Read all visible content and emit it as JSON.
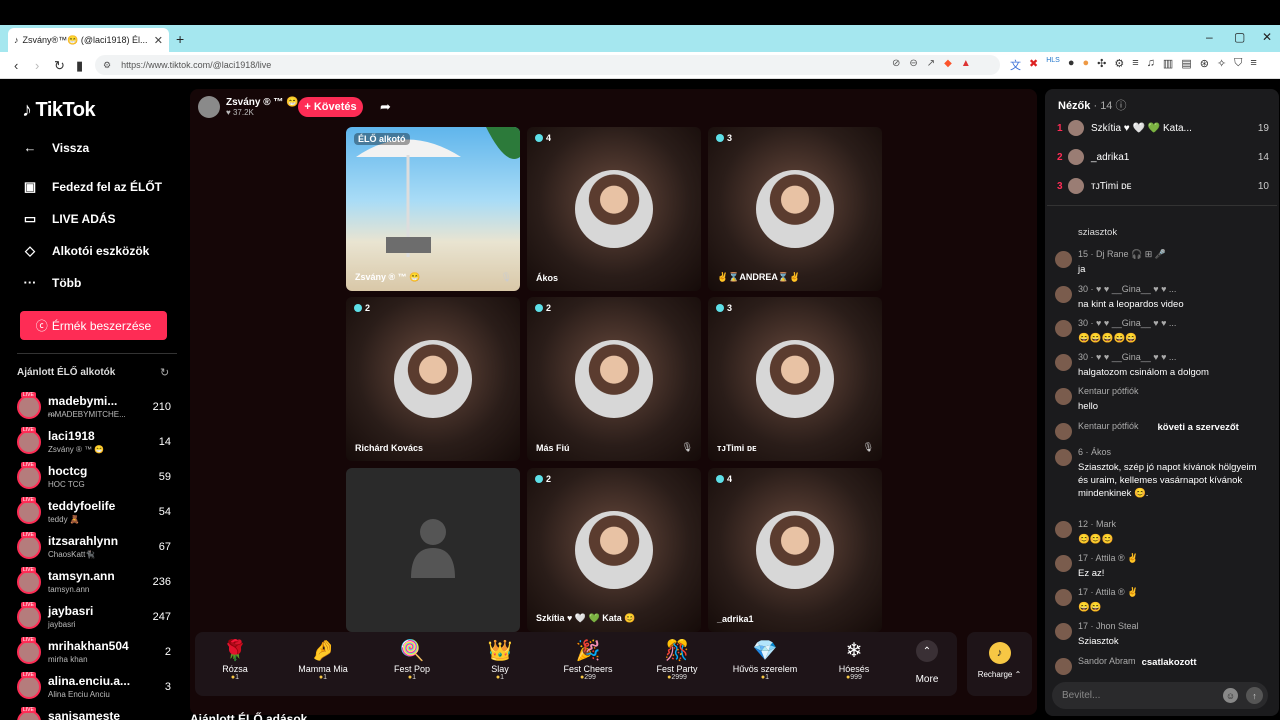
{
  "browser": {
    "tab_title": "Zsvány®™😁 (@laci1918) Él...",
    "tab_close": "✕",
    "new_tab": "+",
    "url": "https://www.tiktok.com/@laci1918/live"
  },
  "sidebar": {
    "logo": "TikTok",
    "nav": [
      {
        "label": "Vissza",
        "icon": "←"
      },
      {
        "label": "Fedezd fel az ÉLŐT",
        "icon": "▣"
      },
      {
        "label": "LIVE ADÁS",
        "icon": "▭"
      },
      {
        "label": "Alkotói eszközök",
        "icon": "◇"
      },
      {
        "label": "Több",
        "icon": "···"
      }
    ],
    "coin_button": "Érmék beszerzése",
    "recommended_title": "Ajánlott ÉLŐ alkotók",
    "creators": [
      {
        "name": "madebymi...",
        "sub": "ᵯMADEBYMITCHE...",
        "count": "210"
      },
      {
        "name": "laci1918",
        "sub": "Zsvány ® ™ 😁",
        "count": "14"
      },
      {
        "name": "hoctcg",
        "sub": "HOC TCG",
        "count": "59"
      },
      {
        "name": "teddyfoelife",
        "sub": "teddy 🧸",
        "count": "54"
      },
      {
        "name": "itzsarahlynn",
        "sub": "ChaosKatt🐈‍⬛",
        "count": "67"
      },
      {
        "name": "tamsyn.ann",
        "sub": "tamsyn.ann",
        "count": "236"
      },
      {
        "name": "jaybasri",
        "sub": "jaybasri",
        "count": "247"
      },
      {
        "name": "mrihakhan504",
        "sub": "mirha khan",
        "count": "2"
      },
      {
        "name": "alina.enciu.a...",
        "sub": "Alina Enciu Anciu",
        "count": "3"
      },
      {
        "name": "sanisameste",
        "sub": "",
        "count": ""
      }
    ]
  },
  "host": {
    "name": "Zsvány ® ™ 😁",
    "likes": "♥ 37.2K",
    "follow": "+ Követés"
  },
  "tiles": [
    {
      "badge": "ÉLŐ alkotó",
      "label": "Zsvány ® ™ 😁"
    },
    {
      "badge": "4",
      "label": "Ákos"
    },
    {
      "badge": "3",
      "label": "✌⌛ANDREA⌛✌"
    },
    {
      "badge": "2",
      "label": "Richárd Kovács"
    },
    {
      "badge": "2",
      "label": "Más Fiú"
    },
    {
      "badge": "3",
      "label": "ᴛᴊTimi ᴅᴇ"
    },
    {
      "badge": "",
      "label": ""
    },
    {
      "badge": "2",
      "label": "Szkítia ♥ 🤍 💚 Kata 😊"
    },
    {
      "badge": "4",
      "label": "_adrika1"
    }
  ],
  "gifts": [
    {
      "name": "Rózsa",
      "price": "1",
      "icon": "🌹"
    },
    {
      "name": "Mamma Mia",
      "price": "1",
      "icon": "🤌"
    },
    {
      "name": "Fest Pop",
      "price": "1",
      "icon": "🍭"
    },
    {
      "name": "Slay",
      "price": "1",
      "icon": "👑"
    },
    {
      "name": "Fest Cheers",
      "price": "299",
      "icon": "🎉"
    },
    {
      "name": "Fest Party",
      "price": "2999",
      "icon": "🎊"
    },
    {
      "name": "Hűvös szerelem",
      "price": "1",
      "icon": "💎"
    },
    {
      "name": "Hóesés",
      "price": "999",
      "icon": "❄"
    }
  ],
  "more_label": "More",
  "recharge_label": "Recharge ⌃",
  "bottom_heading": "Ajánlott ÉLŐ adások",
  "viewers": {
    "title": "Nézők",
    "count": "· 14 ⓘ",
    "top": [
      {
        "rank": "1",
        "name": "Szkítia ♥ 🤍 💚 Kata...",
        "value": "19"
      },
      {
        "rank": "2",
        "name": "_adrika1",
        "value": "14"
      },
      {
        "rank": "3",
        "name": "ᴛᴊTimi ᴅᴇ",
        "value": "10"
      }
    ]
  },
  "chat": [
    {
      "header": "",
      "body": "sziasztok"
    },
    {
      "header": "15 · Dj Rane 🎧 ⊞ 🎤",
      "body": "ja"
    },
    {
      "header": "30 · ♥ ♥ __Gina__ ♥ ♥ ...",
      "body": "na kint a leopardos video"
    },
    {
      "header": "30 · ♥ ♥ __Gina__ ♥ ♥ ...",
      "body": "😄😄😄😄😄"
    },
    {
      "header": "30 · ♥ ♥ __Gina__ ♥ ♥ ...",
      "body": "halgatozom csinálom a dolgom"
    },
    {
      "header": "Kentaur pótfiók",
      "body": "hello"
    },
    {
      "header": "Kentaur pótfiók",
      "body": "követi a szervezőt"
    },
    {
      "header": "6 · Ákos",
      "body": "Sziasztok, szép jó napot kívánok hölgyeim és uraim, kellemes vasárnapot kívánok mindenkinek 😊."
    },
    {
      "header": "12 · Mark",
      "body": "😊😊😊"
    },
    {
      "header": "17 · Attila ® ✌",
      "body": "Ez az!"
    },
    {
      "header": "17 · Attila ® ✌",
      "body": "😄😄"
    },
    {
      "header": "17 · Jhon Steal",
      "body": "Sziasztok"
    },
    {
      "header": "Sandor Abram",
      "body": "csatlakozott"
    }
  ],
  "input_placeholder": "Bevitel..."
}
